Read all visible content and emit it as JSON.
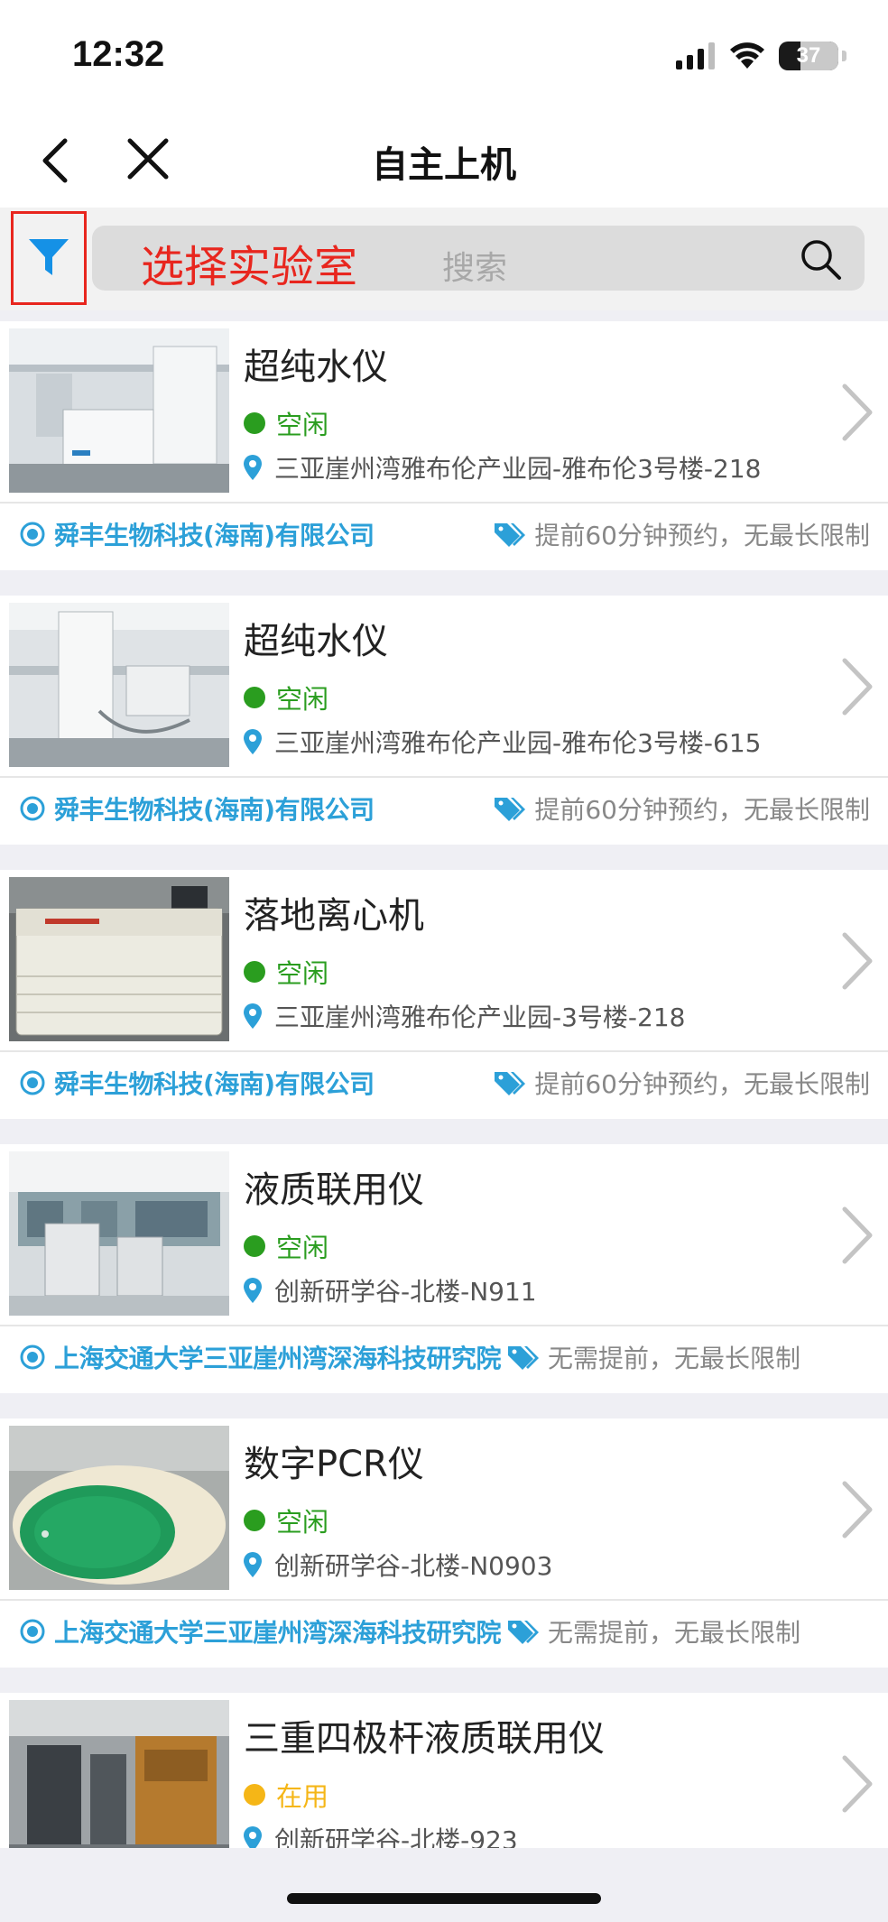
{
  "status_bar": {
    "time": "12:32",
    "battery": "37",
    "battery_level": 0.37
  },
  "nav": {
    "title": "自主上机"
  },
  "search": {
    "annotation": "选择实验室",
    "placeholder": "搜索"
  },
  "colors": {
    "idle": "#2a9d1f",
    "in_use": "#f5b617",
    "org": "#2ca0d8",
    "annotation": "#e8261e"
  },
  "items": [
    {
      "name": "超纯水仪",
      "status": "空闲",
      "status_type": "idle",
      "location": "三亚崖州湾雅布伦产业园-雅布伦3号楼-218",
      "org": "舜丰生物科技(海南)有限公司",
      "booking": "提前60分钟预约，无最长限制"
    },
    {
      "name": "超纯水仪",
      "status": "空闲",
      "status_type": "idle",
      "location": "三亚崖州湾雅布伦产业园-雅布伦3号楼-615",
      "org": "舜丰生物科技(海南)有限公司",
      "booking": "提前60分钟预约，无最长限制"
    },
    {
      "name": "落地离心机",
      "status": "空闲",
      "status_type": "idle",
      "location": "三亚崖州湾雅布伦产业园-3号楼-218",
      "org": "舜丰生物科技(海南)有限公司",
      "booking": "提前60分钟预约，无最长限制"
    },
    {
      "name": "液质联用仪",
      "status": "空闲",
      "status_type": "idle",
      "location": "创新研学谷-北楼-N911",
      "org": "上海交通大学三亚崖州湾深海科技研究院",
      "booking": "无需提前，无最长限制"
    },
    {
      "name": "数字PCR仪",
      "status": "空闲",
      "status_type": "idle",
      "location": "创新研学谷-北楼-N0903",
      "org": "上海交通大学三亚崖州湾深海科技研究院",
      "booking": "无需提前，无最长限制"
    },
    {
      "name": "三重四极杆液质联用仪",
      "status": "在用",
      "status_type": "in_use",
      "location": "创新研学谷-北楼-923",
      "org": "",
      "booking": ""
    }
  ]
}
